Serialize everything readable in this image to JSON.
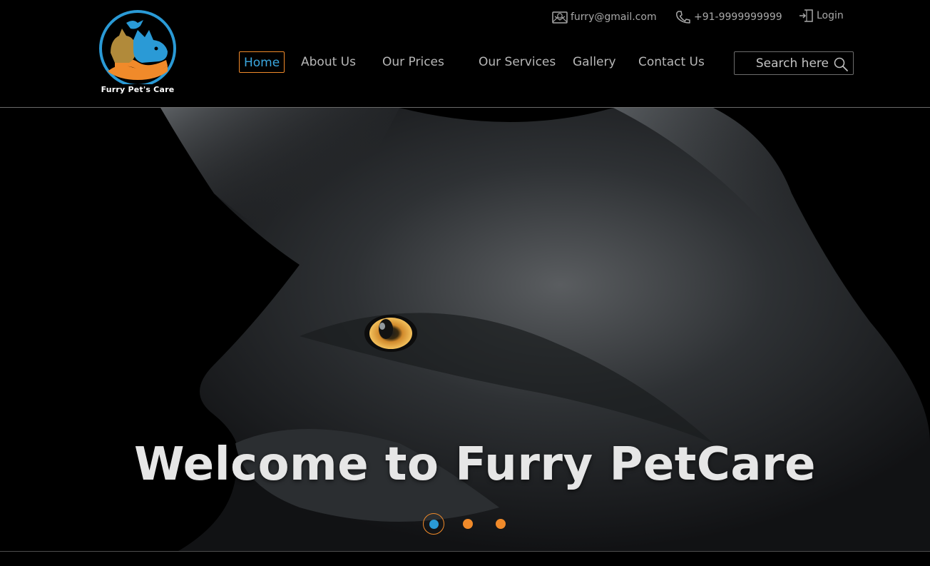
{
  "brand": {
    "logo_text": "Furry Pet's Care"
  },
  "topbar": {
    "email": "furry@gmail.com",
    "phone": "+91-9999999999",
    "login_label": "Login"
  },
  "nav": {
    "items": [
      {
        "label": "Home",
        "active": true
      },
      {
        "label": "About Us"
      },
      {
        "label": "Our Prices"
      },
      {
        "label": "Our Services"
      },
      {
        "label": "Gallery"
      },
      {
        "label": "Contact Us"
      }
    ]
  },
  "search": {
    "placeholder": "Search here"
  },
  "hero": {
    "title": "Welcome to Furry PetCare",
    "slides": {
      "count": 3,
      "active_index": 0
    }
  },
  "icons": {
    "email": "envelope-icon",
    "phone": "phone-icon",
    "login": "login-icon",
    "search": "search-icon"
  },
  "colors": {
    "background": "#000000",
    "accent_orange": "#f08a2a",
    "accent_blue": "#3aa7e0",
    "nav_text": "#b7b7b7"
  }
}
